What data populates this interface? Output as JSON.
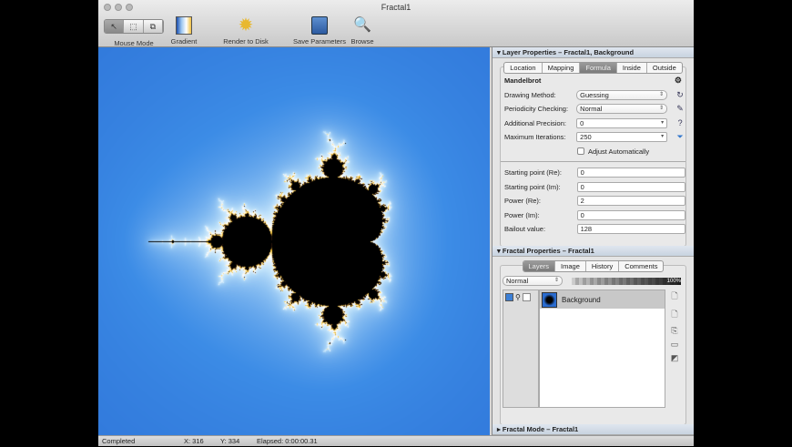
{
  "window": {
    "title": "Fractal1"
  },
  "toolbar": {
    "mouse_mode": "Mouse Mode",
    "gradient": "Gradient",
    "render": "Render to Disk",
    "save": "Save Parameters",
    "browse": "Browse"
  },
  "layer_props": {
    "header": "Layer Properties – Fractal1, Background",
    "tabs": [
      "Location",
      "Mapping",
      "Formula",
      "Inside",
      "Outside"
    ],
    "active_tab": "Formula",
    "formula": "Mandelbrot",
    "drawing_method": {
      "label": "Drawing Method:",
      "value": "Guessing"
    },
    "periodicity": {
      "label": "Periodicity Checking:",
      "value": "Normal"
    },
    "precision": {
      "label": "Additional Precision:",
      "value": "0"
    },
    "iterations": {
      "label": "Maximum Iterations:",
      "value": "250"
    },
    "adjust": {
      "label": "Adjust Automatically",
      "checked": false
    },
    "params": [
      {
        "label": "Starting point (Re):",
        "value": "0"
      },
      {
        "label": "Starting point (Im):",
        "value": "0"
      },
      {
        "label": "Power (Re):",
        "value": "2"
      },
      {
        "label": "Power (Im):",
        "value": "0"
      },
      {
        "label": "Bailout value:",
        "value": "128"
      }
    ]
  },
  "fractal_props": {
    "header": "Fractal Properties – Fractal1",
    "tabs": [
      "Layers",
      "Image",
      "History",
      "Comments"
    ],
    "active_tab": "Layers",
    "blend_mode": "Normal",
    "opacity": "100%",
    "layers": [
      {
        "name": "Background"
      }
    ]
  },
  "fractal_mode": {
    "header": "Fractal Mode – Fractal1"
  },
  "status": {
    "state": "Completed",
    "x": "X: 316",
    "y": "Y: 334",
    "elapsed": "Elapsed: 0:00:00.31"
  }
}
